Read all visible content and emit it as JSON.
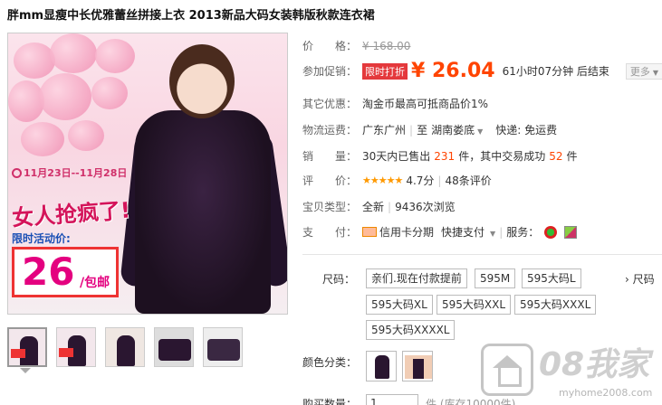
{
  "title": "胖mm显瘦中长优雅蕾丝拼接上衣 2013新品大码女装韩版秋款连衣裙",
  "promo_image": {
    "date_range": "11月23日--11月28日",
    "slogan": "女人抢疯了!",
    "limited_label": "限时活动价:",
    "price": "26",
    "unit": "/包邮"
  },
  "price": {
    "label": "价　　格：",
    "original": "¥ 168.00"
  },
  "promo": {
    "label": "参加促销：",
    "badge": "限时打折",
    "price": "¥ 26.04",
    "countdown": "61小时07分钟 后结束",
    "more": "更多"
  },
  "other_offer": {
    "label": "其它优惠：",
    "text": "淘金币最高可抵商品价1%"
  },
  "shipping": {
    "label": "物流运费：",
    "from": "广东广州",
    "to_prefix": "至",
    "to": "湖南娄底",
    "express": "快递: 免运费"
  },
  "sales": {
    "label": "销　　量：",
    "prefix": "30天内已售出",
    "sold": "231",
    "mid": "件，其中交易成功",
    "success": "52",
    "suffix": "件"
  },
  "rating": {
    "label": "评　　价：",
    "stars": "★★★★★",
    "score": "4.7分",
    "reviews": "48条评价"
  },
  "item_type": {
    "label": "宝贝类型：",
    "condition": "全新",
    "views": "9436次浏览"
  },
  "payment": {
    "label": "支　　付：",
    "installment": "信用卡分期",
    "quick_pay": "快捷支付",
    "service_label": "服务："
  },
  "size": {
    "label": "尺码：",
    "options": [
      "亲们.现在付款提前",
      "595M",
      "595大码L",
      "595大码XL",
      "595大码XXL",
      "595大码XXXL",
      "595大码XXXXL"
    ],
    "chart_link": "尺码"
  },
  "color": {
    "label": "颜色分类："
  },
  "quantity": {
    "label": "购买数量：",
    "value": "1",
    "stock": "件 (库存10000件)"
  },
  "watermark": {
    "text": "08我家",
    "url": "myhome2008.com"
  }
}
